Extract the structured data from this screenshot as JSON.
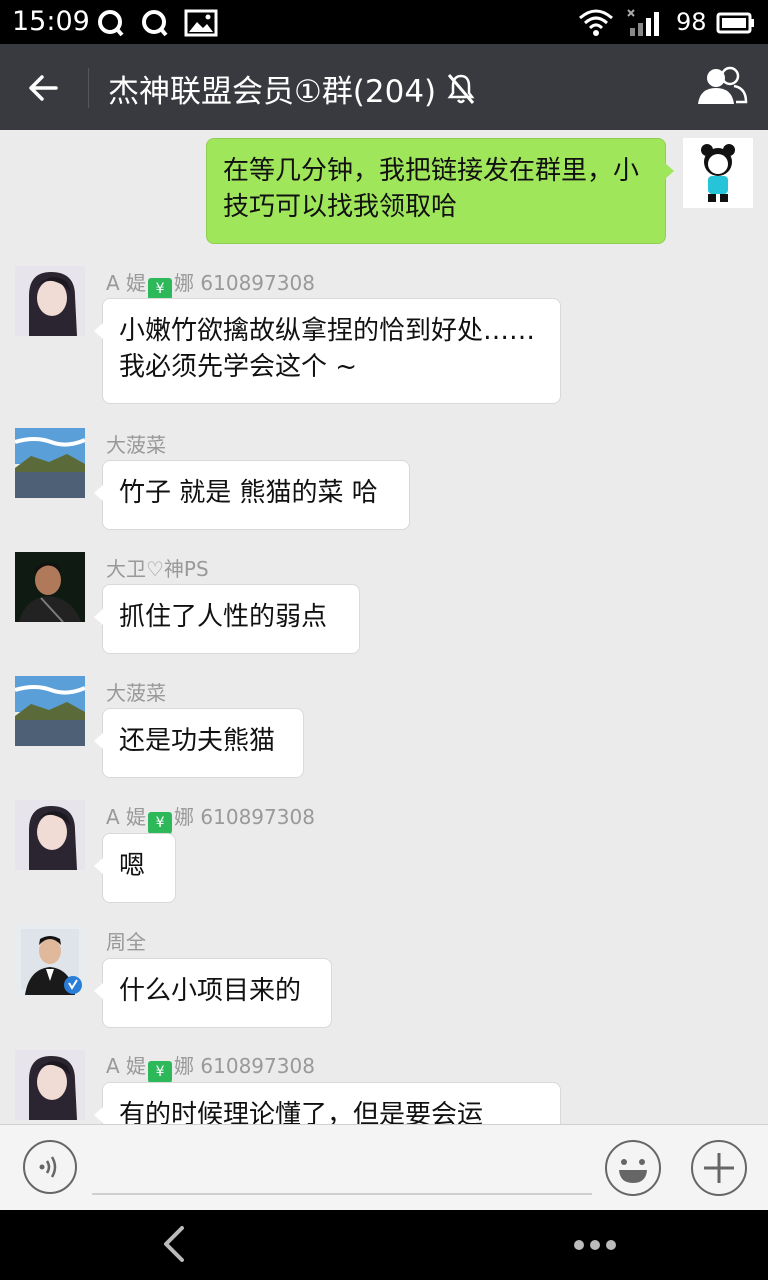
{
  "status_bar": {
    "time": "15:09",
    "battery": "98",
    "icons": [
      "qq-icon",
      "qq-icon",
      "image-icon",
      "wifi-icon",
      "signal-icon",
      "battery-icon"
    ]
  },
  "header": {
    "title": "杰神联盟会员①群(204)",
    "icons": [
      "back-arrow-icon",
      "mute-bell-icon",
      "group-members-icon"
    ]
  },
  "messages": [
    {
      "sender": "",
      "mine": true,
      "text": "在等几分钟，我把链接发在群里，小技巧可以找我领取哈",
      "avatar": "helper-robot-avatar"
    },
    {
      "sender_prefix": "A  媞",
      "sender_suffix": "娜 610897308",
      "text": "小嫩竹欲擒故纵拿捏的恰到好处……我必须先学会这个 ~",
      "avatar": "girl-portrait-avatar"
    },
    {
      "sender": "大菠菜",
      "text": "竹子 就是 熊猫的菜 哈",
      "avatar": "landscape-lake-avatar"
    },
    {
      "sender": "大卫♡神PS",
      "text": "抓住了人性的弱点",
      "avatar": "man-dark-portrait-avatar"
    },
    {
      "sender": "大菠菜",
      "text": "还是功夫熊猫",
      "avatar": "landscape-lake-avatar"
    },
    {
      "sender_prefix": "A  媞",
      "sender_suffix": "娜 610897308",
      "text": "嗯",
      "avatar": "girl-portrait-avatar"
    },
    {
      "sender": "周全",
      "text": "什么小项目来的",
      "avatar": "man-suit-portrait-avatar"
    },
    {
      "sender_prefix": "A  媞",
      "sender_suffix": "娜 610897308",
      "text": "有的时候理论懂了，但是要会运",
      "avatar": "girl-portrait-avatar"
    }
  ],
  "input_bar": {
    "icons": [
      "voice-icon",
      "emoji-icon",
      "plus-icon"
    ]
  },
  "nav_bar": {
    "icons": [
      "back-chevron-icon",
      "more-dots-icon"
    ]
  },
  "colors": {
    "header_bg": "#393a3f",
    "chat_bg": "#ebebeb",
    "my_bubble": "#9fe65a",
    "their_bubble": "#ffffff"
  }
}
